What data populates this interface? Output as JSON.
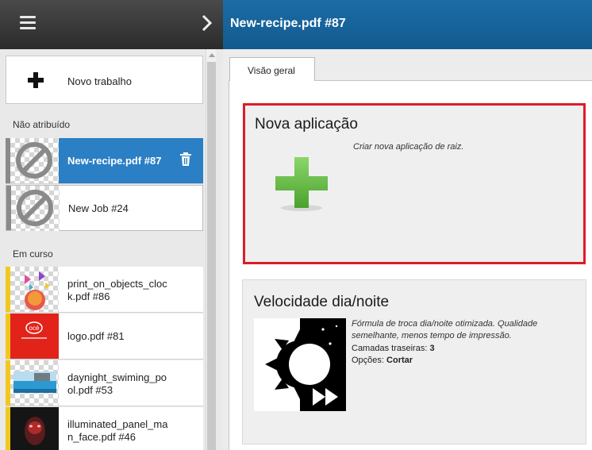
{
  "header": {
    "title": "New-recipe.pdf #87"
  },
  "sidebar": {
    "new_job_label": "Novo trabalho",
    "unassigned_label": "Não atribuído",
    "in_progress_label": "Em curso",
    "unassigned_jobs": [
      {
        "name": "New-recipe.pdf #87",
        "selected": true
      },
      {
        "name": "New Job #24",
        "selected": false
      }
    ],
    "in_progress_jobs": [
      {
        "name": "print_on_objects_clock.pdf #86",
        "line1": "print_on_objects_cloc",
        "line2": "k.pdf #86"
      },
      {
        "name": "logo.pdf #81",
        "line1": "logo.pdf #81",
        "line2": ""
      },
      {
        "name": "daynight_swiming_pool.pdf #53",
        "line1": "daynight_swiming_po",
        "line2": "ol.pdf #53"
      },
      {
        "name": "illuminated_panel_man_face.pdf #46",
        "line1": "illuminated_panel_ma",
        "line2": "n_face.pdf #46"
      }
    ],
    "logo_thumb_text": "océ"
  },
  "main": {
    "tabs": [
      {
        "label": "Visão geral"
      }
    ],
    "cards": [
      {
        "title": "Nova aplicação",
        "description": "Criar nova aplicação de raiz."
      },
      {
        "title": "Velocidade dia/noite",
        "description": "Fórmula de troca dia/noite otimizada. Qualidade semelhante, menos tempo de impressão.",
        "back_layers_label": "Camadas traseiras:",
        "back_layers_value": "3",
        "options_label": "Opções:",
        "options_value": "Cortar"
      }
    ]
  },
  "colors": {
    "header_blue": "#1d6ca6",
    "selected_blue": "#2b7fc5",
    "highlight_red": "#dd1c2a",
    "in_progress_stripe": "#f2c81f",
    "unassigned_stripe": "#8a8a8a",
    "add_green": "#5cb83f"
  },
  "icons": [
    "menu-icon",
    "chevron-right-icon",
    "plus-icon",
    "trash-icon",
    "no-preview-icon",
    "green-plus-icon",
    "day-night-icon"
  ]
}
